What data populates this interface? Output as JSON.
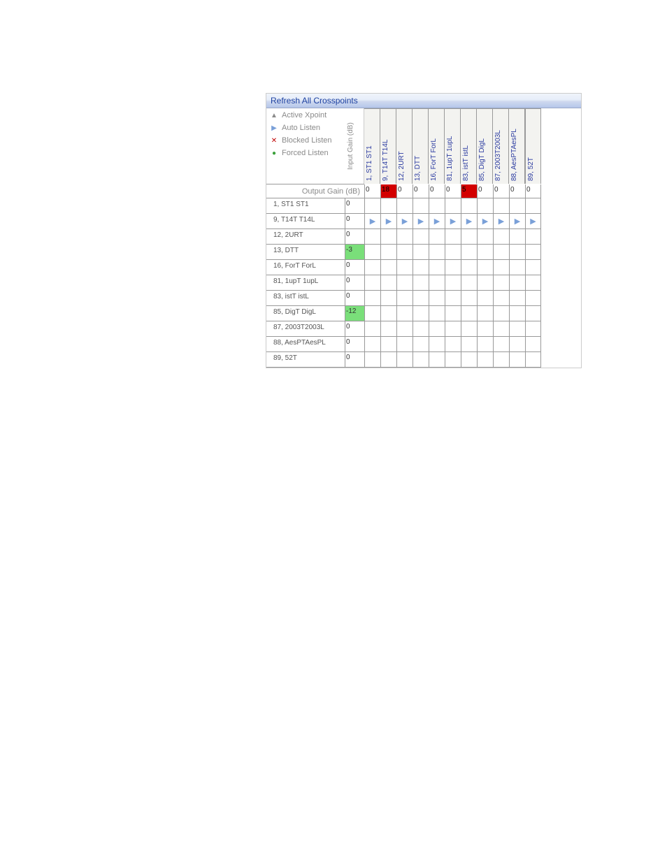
{
  "header": {
    "title": "Refresh All Crosspoints"
  },
  "legend": {
    "items": [
      {
        "icon": "▲",
        "color": "#8a8a8a",
        "label": "Active Xpoint"
      },
      {
        "icon": "▶",
        "color": "#7aa0d8",
        "label": "Auto Listen"
      },
      {
        "icon": "✕",
        "color": "#c00000",
        "label": "Blocked Listen"
      },
      {
        "icon": "●",
        "color": "#3aa03a",
        "label": "Forced Listen"
      }
    ],
    "input_gain_label": "Input Gain (dB)"
  },
  "columns": [
    "1, ST1 ST1",
    "9, T14T T14L",
    "12, 2URT",
    "13, DTT",
    "16, ForT ForL",
    "81, 1upT 1upL",
    "83, istT istL",
    "85, DigT DigL",
    "87, 2003T2003L",
    "88, AesPTAesPL",
    "89, 52T"
  ],
  "output_gain": {
    "label": "Output Gain (dB)",
    "values": [
      {
        "v": "0"
      },
      {
        "v": "18",
        "red": true
      },
      {
        "v": "0"
      },
      {
        "v": "0"
      },
      {
        "v": "0"
      },
      {
        "v": "0"
      },
      {
        "v": "5",
        "red": true
      },
      {
        "v": "0"
      },
      {
        "v": "0"
      },
      {
        "v": "0"
      },
      {
        "v": "0"
      }
    ]
  },
  "rows": [
    {
      "label": "1, ST1 ST1",
      "gain": "0",
      "cells": [
        "",
        "",
        "",
        "",
        "",
        "",
        "",
        "",
        "",
        "",
        ""
      ]
    },
    {
      "label": "9, T14T T14L",
      "gain": "0",
      "cells": [
        "auto",
        "auto",
        "auto",
        "auto",
        "auto",
        "auto",
        "auto",
        "auto",
        "auto",
        "auto",
        "auto"
      ]
    },
    {
      "label": "12, 2URT",
      "gain": "0",
      "cells": [
        "",
        "",
        "",
        "",
        "",
        "",
        "",
        "",
        "",
        "",
        ""
      ]
    },
    {
      "label": "13, DTT",
      "gain": "-3",
      "gain_green": true,
      "cells": [
        "",
        "",
        "",
        "",
        "",
        "",
        "",
        "",
        "",
        "",
        ""
      ]
    },
    {
      "label": "16, ForT ForL",
      "gain": "0",
      "cells": [
        "",
        "",
        "",
        "",
        "",
        "",
        "",
        "",
        "",
        "",
        ""
      ]
    },
    {
      "label": "81, 1upT 1upL",
      "gain": "0",
      "cells": [
        "",
        "",
        "",
        "",
        "",
        "",
        "",
        "",
        "",
        "",
        ""
      ]
    },
    {
      "label": "83, istT istL",
      "gain": "0",
      "cells": [
        "",
        "",
        "",
        "",
        "",
        "",
        "",
        "",
        "",
        "",
        ""
      ]
    },
    {
      "label": "85, DigT DigL",
      "gain": "-12",
      "gain_green": true,
      "cells": [
        "",
        "",
        "",
        "",
        "",
        "",
        "",
        "",
        "",
        "",
        ""
      ]
    },
    {
      "label": "87, 2003T2003L",
      "gain": "0",
      "cells": [
        "",
        "",
        "",
        "",
        "",
        "",
        "",
        "",
        "",
        "",
        ""
      ]
    },
    {
      "label": "88, AesPTAesPL",
      "gain": "0",
      "cells": [
        "",
        "",
        "",
        "",
        "",
        "",
        "",
        "",
        "",
        "",
        ""
      ]
    },
    {
      "label": "89, 52T",
      "gain": "0",
      "cells": [
        "",
        "",
        "",
        "",
        "",
        "",
        "",
        "",
        "",
        "",
        ""
      ]
    }
  ]
}
